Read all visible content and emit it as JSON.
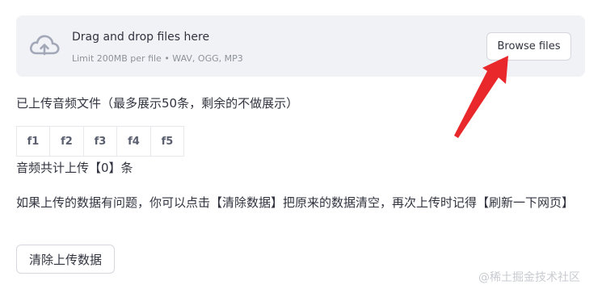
{
  "uploader": {
    "title": "Drag and drop files here",
    "subtitle": "Limit 200MB per file • WAV, OGG, MP3",
    "browse_label": "Browse files",
    "icon": "cloud-upload-icon"
  },
  "uploaded_header": "已上传音频文件（最多展示50条，剩余的不做展示）",
  "table": {
    "columns": [
      "f1",
      "f2",
      "f3",
      "f4",
      "f5"
    ]
  },
  "count_text": "音频共计上传【0】条",
  "notice": "如果上传的数据有问题，你可以点击【清除数据】把原来的数据清空，再次上传时记得【刷新一下网页】",
  "clear_button_label": "清除上传数据",
  "watermark": "@稀土掘金技术社区",
  "colors": {
    "arrow": "#e8282b",
    "dropzone_bg": "#f0f2f6",
    "icon": "#a3a8b8"
  }
}
